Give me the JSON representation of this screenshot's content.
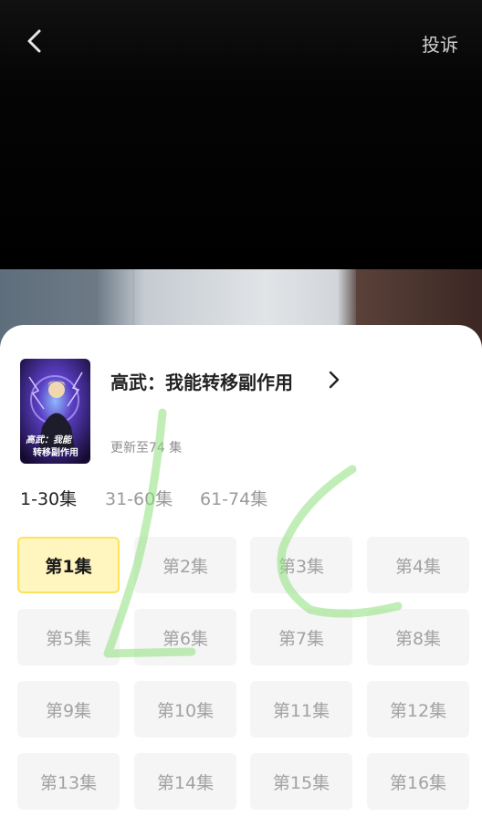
{
  "header": {
    "back_icon": "chevron-left-icon",
    "complaint_label": "投诉"
  },
  "drama": {
    "title": "高武：我能转移副作用",
    "update_text": "更新至74 集",
    "poster_text_line1": "高武：我能",
    "poster_text_line2": "转移副作用"
  },
  "range_tabs": [
    "1-30集",
    "31-60集",
    "61-74集"
  ],
  "active_range_index": 0,
  "episodes": [
    "第1集",
    "第2集",
    "第3集",
    "第4集",
    "第5集",
    "第6集",
    "第7集",
    "第8集",
    "第9集",
    "第10集",
    "第11集",
    "第12集",
    "第13集",
    "第14集",
    "第15集",
    "第16集"
  ],
  "active_episode_index": 0,
  "colors": {
    "active_episode_bg": "#fff5bf",
    "active_episode_border": "#fde25d",
    "overlay_scribble": "#8ee07a"
  }
}
